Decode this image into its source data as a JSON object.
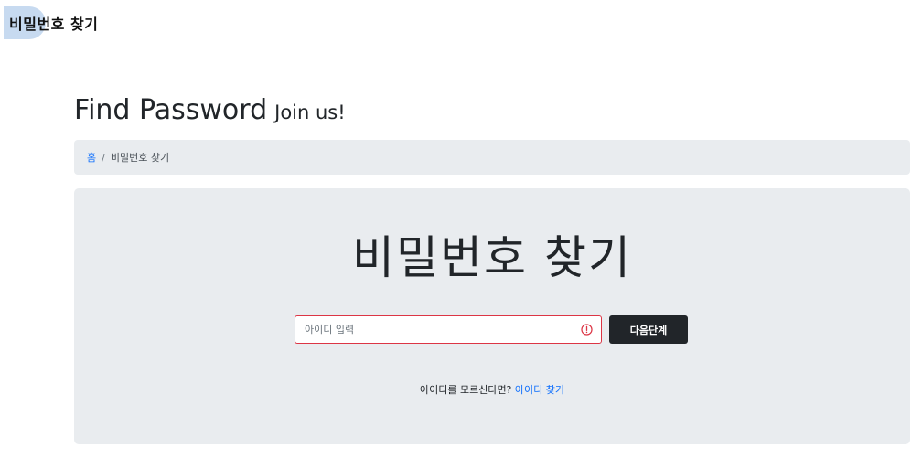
{
  "top_badge": {
    "label": "비밀번호 찾기"
  },
  "header": {
    "title": "Find Password",
    "subtitle": "Join us!"
  },
  "breadcrumb": {
    "home": "홈",
    "separator": "/",
    "current": "비밀번호 찾기"
  },
  "main": {
    "title": "비밀번호 찾기",
    "id_input": {
      "placeholder": "아이디 입력",
      "value": "",
      "state": "invalid"
    },
    "next_button": "다음단계",
    "hint_text": "아이디를 모르신다면?",
    "hint_link": "아이디 찾기"
  },
  "colors": {
    "accent_blue": "#0d6efd",
    "invalid_red": "#dc3545",
    "panel_bg": "#e9ecef",
    "dark_button": "#212529",
    "badge_bg": "#c7daf0"
  },
  "icons": {
    "input_status": "exclamation-circle-icon"
  }
}
